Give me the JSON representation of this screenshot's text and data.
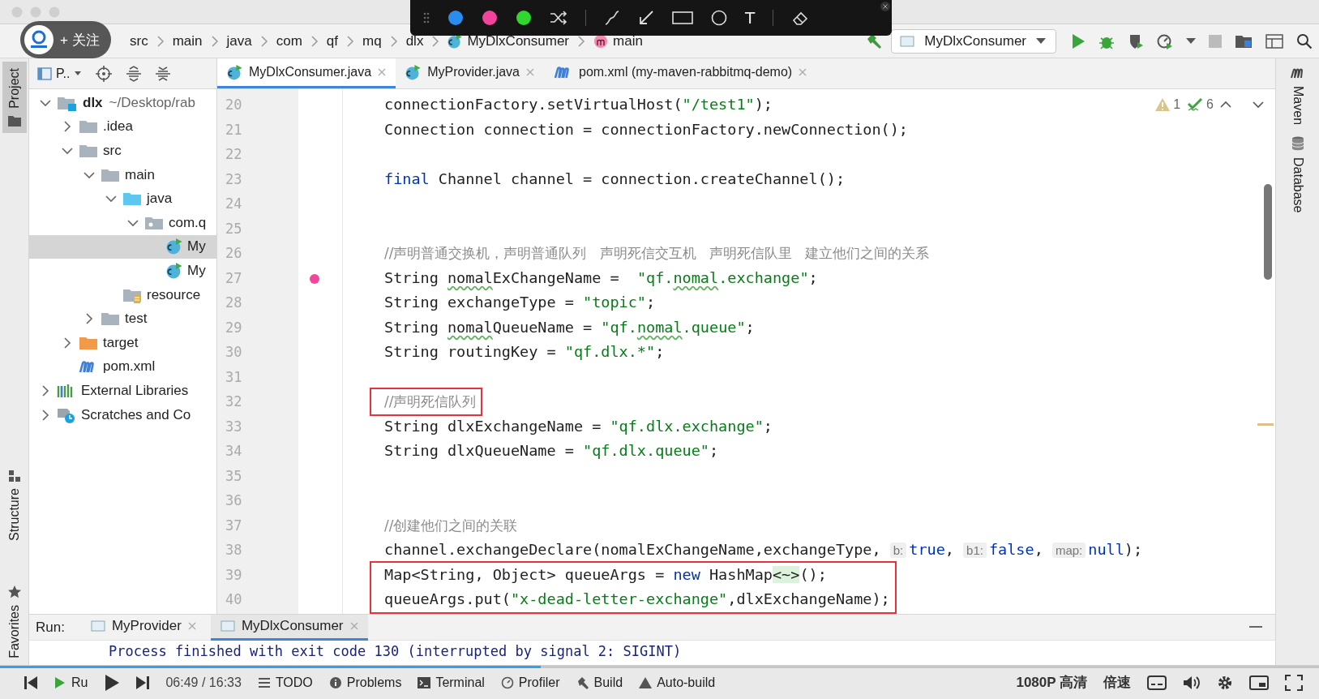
{
  "annotation_toolbar": {
    "colors": [
      {
        "color": "#2b8cf0"
      },
      {
        "color": "#f2449a"
      },
      {
        "color": "#2fd72f"
      }
    ],
    "text_tool": "T"
  },
  "follow_badge": {
    "label": "+ 关注"
  },
  "breadcrumbs": [
    {
      "label": "src",
      "kind": "folder"
    },
    {
      "label": "main",
      "kind": "folder"
    },
    {
      "label": "java",
      "kind": "folder"
    },
    {
      "label": "com",
      "kind": "folder"
    },
    {
      "label": "qf",
      "kind": "folder"
    },
    {
      "label": "mq",
      "kind": "folder"
    },
    {
      "label": "dlx",
      "kind": "folder"
    },
    {
      "label": "MyDlxConsumer",
      "kind": "class"
    },
    {
      "label": "main",
      "kind": "method"
    }
  ],
  "run_config": {
    "label": "MyDlxConsumer"
  },
  "side_tabs_left": [
    {
      "label": "Project",
      "selected": true
    },
    {
      "label": "Structure",
      "selected": false
    },
    {
      "label": "Favorites",
      "selected": false
    }
  ],
  "side_tabs_right": [
    {
      "label": "Maven",
      "kind": "maven"
    },
    {
      "label": "Database",
      "kind": "database"
    }
  ],
  "project_panel": {
    "title": "P..",
    "tree": [
      {
        "label": "dlx",
        "detail": "~/Desktop/rab",
        "kind": "module",
        "expanded": true,
        "selected": false,
        "children": [
          {
            "label": ".idea",
            "kind": "folder",
            "expanded": false,
            "selected": false
          },
          {
            "label": "src",
            "kind": "folder",
            "expanded": true,
            "selected": false,
            "children": [
              {
                "label": "main",
                "kind": "folder",
                "expanded": true,
                "selected": false,
                "children": [
                  {
                    "label": "java",
                    "kind": "source-folder",
                    "expanded": true,
                    "selected": false,
                    "children": [
                      {
                        "label": "com.q",
                        "kind": "package",
                        "expanded": true,
                        "selected": false,
                        "children": [
                          {
                            "label": "My",
                            "kind": "class",
                            "selected": true
                          },
                          {
                            "label": "My",
                            "kind": "class",
                            "selected": false
                          }
                        ]
                      }
                    ]
                  },
                  {
                    "label": "resource",
                    "kind": "resources",
                    "selected": false
                  }
                ]
              },
              {
                "label": "test",
                "kind": "folder",
                "expanded": false,
                "selected": false
              }
            ]
          },
          {
            "label": "target",
            "kind": "excluded-folder",
            "expanded": false,
            "selected": false
          },
          {
            "label": "pom.xml",
            "kind": "maven",
            "selected": false
          }
        ]
      },
      {
        "label": "External Libraries",
        "kind": "libraries",
        "expanded": false,
        "selected": false
      },
      {
        "label": "Scratches and Co",
        "kind": "scratches",
        "expanded": false,
        "selected": false
      }
    ]
  },
  "editor_tabs": [
    {
      "label": "MyDlxConsumer.java",
      "kind": "class",
      "selected": true
    },
    {
      "label": "MyProvider.java",
      "kind": "class",
      "selected": false
    },
    {
      "label": "pom.xml (my-maven-rabbitmq-demo)",
      "kind": "maven",
      "selected": false
    }
  ],
  "inspections": {
    "warnings": "1",
    "weak_warnings": "6"
  },
  "code_lines": [
    {
      "number": "20",
      "annotated": false,
      "segments": [
        {
          "kind": "plain",
          "text": "connectionFactory.setVirtualHost("
        },
        {
          "kind": "string",
          "text": "\"/test1\""
        },
        {
          "kind": "plain",
          "text": ");"
        }
      ]
    },
    {
      "number": "21",
      "annotated": false,
      "segments": [
        {
          "kind": "plain",
          "text": "Connection connection = connectionFactory.newConnection();"
        }
      ]
    },
    {
      "number": "22",
      "annotated": false
    },
    {
      "number": "23",
      "annotated": false,
      "segments": [
        {
          "kind": "keyword",
          "text": "final"
        },
        {
          "kind": "plain",
          "text": " Channel channel = connection.createChannel();"
        }
      ]
    },
    {
      "number": "24",
      "annotated": false
    },
    {
      "number": "25",
      "annotated": false
    },
    {
      "number": "26",
      "annotated": false,
      "segments": [
        {
          "kind": "comment",
          "text": "//声明普通交换机，声明普通队列   声明死信交互机   声明死信队里   建立他们之间的关系"
        }
      ]
    },
    {
      "number": "27",
      "annotated": false,
      "segments": [
        {
          "kind": "plain",
          "text": "String "
        },
        {
          "kind": "typo",
          "text": "nomal"
        },
        {
          "kind": "plain",
          "text": "ExChangeName =  "
        },
        {
          "kind": "string",
          "text": "\"qf."
        },
        {
          "kind": "string-typo",
          "text": "nomal"
        },
        {
          "kind": "string",
          "text": ".exchange\""
        },
        {
          "kind": "plain",
          "text": ";"
        }
      ]
    },
    {
      "number": "28",
      "annotated": false,
      "segments": [
        {
          "kind": "plain",
          "text": "String exchangeType = "
        },
        {
          "kind": "string",
          "text": "\"topic\""
        },
        {
          "kind": "plain",
          "text": ";"
        }
      ]
    },
    {
      "number": "29",
      "annotated": false,
      "segments": [
        {
          "kind": "plain",
          "text": "String "
        },
        {
          "kind": "typo",
          "text": "nomal"
        },
        {
          "kind": "plain",
          "text": "QueueName = "
        },
        {
          "kind": "string",
          "text": "\"qf."
        },
        {
          "kind": "string-typo",
          "text": "nomal"
        },
        {
          "kind": "string",
          "text": ".queue\""
        },
        {
          "kind": "plain",
          "text": ";"
        }
      ]
    },
    {
      "number": "30",
      "annotated": false,
      "segments": [
        {
          "kind": "plain",
          "text": "String routingKey = "
        },
        {
          "kind": "string",
          "text": "\"qf.dlx.*\""
        },
        {
          "kind": "plain",
          "text": ";"
        }
      ]
    },
    {
      "number": "31",
      "annotated": false
    },
    {
      "number": "32",
      "annotated": true,
      "segments": [
        {
          "kind": "comment",
          "text": "//声明死信队列"
        }
      ]
    },
    {
      "number": "33",
      "annotated": false,
      "segments": [
        {
          "kind": "plain",
          "text": "String dlxExchangeName = "
        },
        {
          "kind": "string",
          "text": "\"qf.dlx.exchange\""
        },
        {
          "kind": "plain",
          "text": ";"
        }
      ]
    },
    {
      "number": "34",
      "annotated": false,
      "segments": [
        {
          "kind": "plain",
          "text": "String dlxQueueName = "
        },
        {
          "kind": "string",
          "text": "\"qf.dlx.queue\""
        },
        {
          "kind": "plain",
          "text": ";"
        }
      ]
    },
    {
      "number": "35",
      "annotated": false
    },
    {
      "number": "36",
      "annotated": false
    },
    {
      "number": "37",
      "annotated": false,
      "segments": [
        {
          "kind": "comment",
          "text": "//创建他们之间的关联"
        }
      ]
    },
    {
      "number": "38",
      "annotated": false,
      "segments": [
        {
          "kind": "plain",
          "text": "channel.exchangeDeclare(nomalExChangeName,exchangeType, "
        },
        {
          "kind": "hint",
          "text": "b:"
        },
        {
          "kind": "keyword",
          "text": "true"
        },
        {
          "kind": "plain",
          "text": ", "
        },
        {
          "kind": "hint",
          "text": "b1:"
        },
        {
          "kind": "keyword",
          "text": "false"
        },
        {
          "kind": "plain",
          "text": ", "
        },
        {
          "kind": "hint",
          "text": "map:"
        },
        {
          "kind": "keyword",
          "text": "null"
        },
        {
          "kind": "plain",
          "text": ");"
        }
      ]
    },
    {
      "number": "39",
      "annotated": true,
      "segments": [
        {
          "kind": "plain",
          "text": "Map<String, Object> queueArgs = "
        },
        {
          "kind": "keyword",
          "text": "new"
        },
        {
          "kind": "plain",
          "text": " HashMap"
        },
        {
          "kind": "folded",
          "text": "<~>"
        },
        {
          "kind": "plain",
          "text": "();"
        }
      ]
    },
    {
      "number": "40",
      "annotated": true,
      "segments": [
        {
          "kind": "plain",
          "text": "queueArgs.put("
        },
        {
          "kind": "string",
          "text": "\"x-dead-letter-exchange\""
        },
        {
          "kind": "plain",
          "text": ",dlxExchangeName);"
        }
      ]
    }
  ],
  "run_panel": {
    "label": "Run:",
    "tabs": [
      {
        "label": "MyProvider",
        "selected": false
      },
      {
        "label": "MyDlxConsumer",
        "selected": true
      }
    ],
    "output": "Process finished with exit code 130 (interrupted by signal 2: SIGINT)"
  },
  "tool_window_bar": [
    {
      "label": "Ru",
      "kind": "run"
    },
    {
      "label": "TODO",
      "kind": "list"
    },
    {
      "label": "Problems",
      "kind": "info"
    },
    {
      "label": "Terminal",
      "kind": "terminal"
    },
    {
      "label": "Profiler",
      "kind": "profiler"
    },
    {
      "label": "Build",
      "kind": "hammer"
    },
    {
      "label": "Auto-build",
      "kind": "warning"
    }
  ],
  "video_player": {
    "level": 0.41,
    "time": "06:49 / 16:33",
    "quality": "1080P 高清",
    "speed": "倍速"
  }
}
